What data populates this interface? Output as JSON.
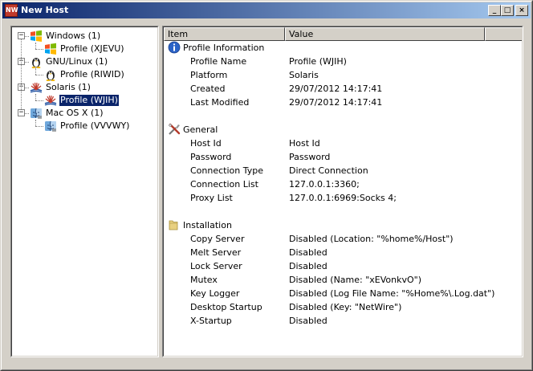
{
  "window": {
    "title": "New Host",
    "app_icon": "netwire-app-icon",
    "app_icon_text": "NW",
    "min_symbol": "_",
    "max_symbol": "□",
    "close_symbol": "×"
  },
  "tree": {
    "nodes": [
      {
        "label": "Windows (1)",
        "icon": "windows-logo-icon",
        "expanded": true,
        "children": [
          {
            "label": "Profile (XJEVU)",
            "icon": "windows-logo-icon",
            "selected": false
          }
        ]
      },
      {
        "label": "GNU/Linux (1)",
        "icon": "linux-penguin-icon",
        "expanded": true,
        "children": [
          {
            "label": "Profile (RIWID)",
            "icon": "linux-penguin-icon",
            "selected": false
          }
        ]
      },
      {
        "label": "Solaris (1)",
        "icon": "solaris-logo-icon",
        "expanded": true,
        "children": [
          {
            "label": "Profile (WJIH)",
            "icon": "solaris-logo-icon",
            "selected": true
          }
        ]
      },
      {
        "label": "Mac OS X (1)",
        "icon": "mac-finder-icon",
        "expanded": true,
        "children": [
          {
            "label": "Profile (VVVWY)",
            "icon": "mac-finder-icon",
            "selected": false
          }
        ]
      }
    ],
    "expander_symbol": "−"
  },
  "list": {
    "columns": [
      "Item",
      "Value"
    ],
    "groups": [
      {
        "label": "Profile Information",
        "icon": "info-icon",
        "rows": [
          {
            "item": "Profile Name",
            "value": "Profile (WJIH)"
          },
          {
            "item": "Platform",
            "value": "Solaris"
          },
          {
            "item": "Created",
            "value": "29/07/2012 14:17:41"
          },
          {
            "item": "Last Modified",
            "value": "29/07/2012 14:17:41"
          }
        ]
      },
      {
        "label": "General",
        "icon": "tools-icon",
        "rows": [
          {
            "item": "Host Id",
            "value": "Host Id"
          },
          {
            "item": "Password",
            "value": "Password"
          },
          {
            "item": "Connection Type",
            "value": "Direct Connection"
          },
          {
            "item": "Connection List",
            "value": "127.0.0.1:3360;"
          },
          {
            "item": "Proxy List",
            "value": "127.0.0.1:6969:Socks 4;"
          }
        ]
      },
      {
        "label": "Installation",
        "icon": "folder-icon",
        "rows": [
          {
            "item": "Copy Server",
            "value": "Disabled (Location: \"%home%/Host\")"
          },
          {
            "item": "Melt Server",
            "value": "Disabled"
          },
          {
            "item": "Lock Server",
            "value": "Disabled"
          },
          {
            "item": "Mutex",
            "value": "Disabled (Name: \"xEVonkvO\")"
          },
          {
            "item": "Key Logger",
            "value": "Disabled (Log File Name: \"%Home%\\.Log.dat\")"
          },
          {
            "item": "Desktop Startup",
            "value": "Disabled (Key: \"NetWire\")"
          },
          {
            "item": "X-Startup",
            "value": "Disabled"
          }
        ]
      }
    ]
  },
  "colors": {
    "title_start": "#0a246a",
    "title_end": "#a6caf0",
    "selection": "#0a246a",
    "face": "#d4d0c8"
  }
}
